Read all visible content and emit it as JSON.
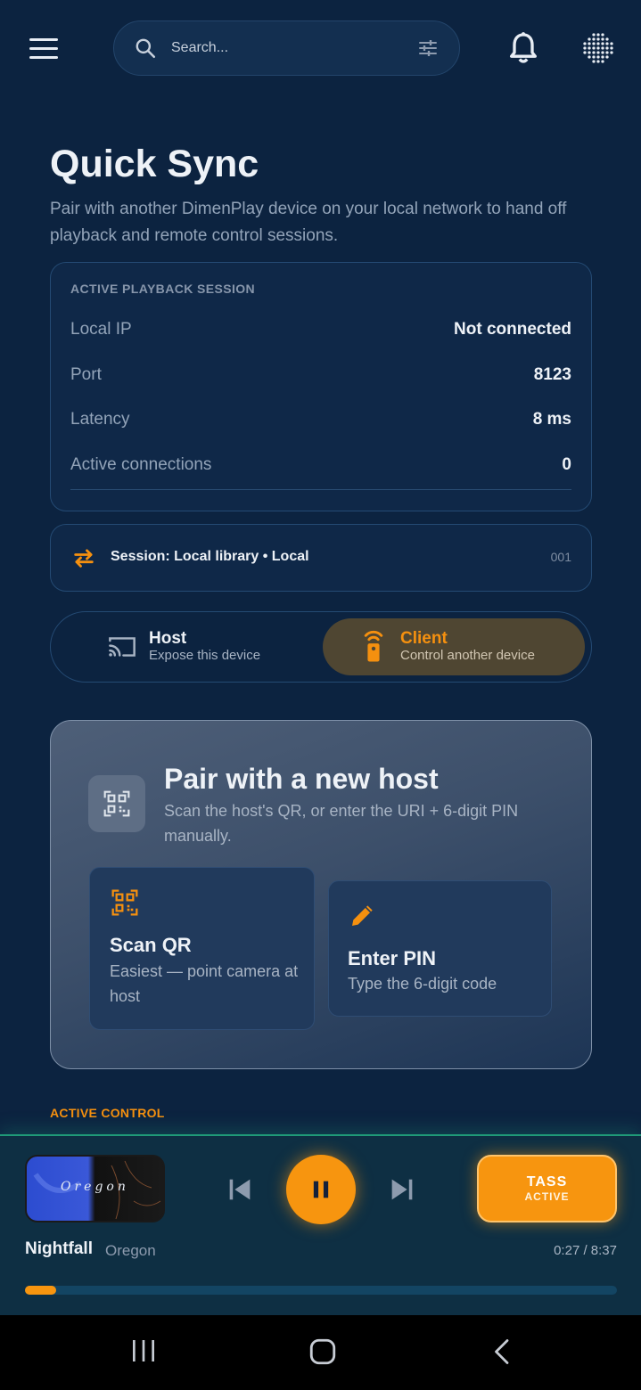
{
  "topbar": {
    "search_placeholder": "Search..."
  },
  "header": {
    "title": "Quick Sync",
    "subtitle": "Pair with another DimenPlay device on your local network to hand off playback and remote control sessions."
  },
  "session_card": {
    "label": "ACTIVE PLAYBACK SESSION",
    "rows": [
      {
        "label": "Local IP",
        "value": "Not connected"
      },
      {
        "label": "Port",
        "value": "8123"
      },
      {
        "label": "Latency",
        "value": "8 ms"
      },
      {
        "label": "Active connections",
        "value": "0"
      }
    ]
  },
  "session_chip": {
    "text": "Session: Local library • Local",
    "id": "001"
  },
  "mode": {
    "selected": "client",
    "host": {
      "title": "Host",
      "subtitle": "Expose this device"
    },
    "client": {
      "title": "Client",
      "subtitle": "Control another device"
    }
  },
  "pair": {
    "title": "Pair with a new host",
    "subtitle": "Scan the host's QR, or enter the URI + 6-digit PIN manually.",
    "scan": {
      "title": "Scan QR",
      "subtitle": "Easiest — point camera at host"
    },
    "pin": {
      "title": "Enter PIN",
      "subtitle": "Type the 6-digit code"
    }
  },
  "section_label": "ACTIVE CONTROL",
  "player": {
    "art_text": "Oregon",
    "track": "Nightfall",
    "artist": "Oregon",
    "time": "0:27 / 8:37",
    "progress": 0.052,
    "tass_title": "TASS",
    "tass_sub": "ACTIVE",
    "state": "playing"
  },
  "colors": {
    "accent": "#f7950f",
    "background": "#0c2340",
    "player_glow": "#1f9a78"
  },
  "icons": [
    "menu-icon",
    "search-icon",
    "tune-icon",
    "bell-icon",
    "dots-grid-icon",
    "swap-icon",
    "cast-icon",
    "remote-icon",
    "qr-icon",
    "pencil-icon",
    "skip-previous-icon",
    "pause-icon",
    "skip-next-icon",
    "recents-icon",
    "home-icon",
    "back-icon"
  ]
}
